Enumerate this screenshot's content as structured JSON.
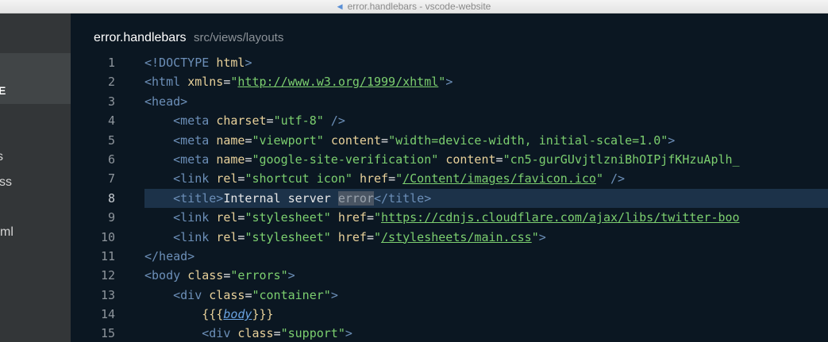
{
  "window": {
    "title": "error.handlebars - vscode-website"
  },
  "sidebar": {
    "section_title": "TE",
    "items": [
      {
        "label": "s"
      },
      {
        "label": "css"
      },
      {
        "label": "xml"
      }
    ]
  },
  "editor": {
    "file_name": "error.handlebars",
    "file_path": "src/views/layouts",
    "highlighted_line": 8,
    "lines": [
      {
        "n": "1",
        "tokens": [
          [
            "tag",
            "<!DOCTYPE "
          ],
          [
            "attr",
            "html"
          ],
          [
            "tag",
            ">"
          ]
        ]
      },
      {
        "n": "2",
        "tokens": [
          [
            "tag",
            "<html "
          ],
          [
            "attr",
            "xmlns"
          ],
          [
            "eq",
            "="
          ],
          [
            "str",
            "\""
          ],
          [
            "link",
            "http://www.w3.org/1999/xhtml"
          ],
          [
            "str",
            "\""
          ],
          [
            "tag",
            ">"
          ]
        ]
      },
      {
        "n": "3",
        "tokens": [
          [
            "tag",
            "<head>"
          ]
        ]
      },
      {
        "n": "4",
        "tokens": [
          [
            "txt",
            "    "
          ],
          [
            "tag",
            "<meta "
          ],
          [
            "attr",
            "charset"
          ],
          [
            "eq",
            "="
          ],
          [
            "str",
            "\"utf-8\""
          ],
          [
            "tag",
            " />"
          ]
        ]
      },
      {
        "n": "5",
        "tokens": [
          [
            "txt",
            "    "
          ],
          [
            "tag",
            "<meta "
          ],
          [
            "attr",
            "name"
          ],
          [
            "eq",
            "="
          ],
          [
            "str",
            "\"viewport\""
          ],
          [
            "txt",
            " "
          ],
          [
            "attr",
            "content"
          ],
          [
            "eq",
            "="
          ],
          [
            "str",
            "\"width=device-width, initial-scale=1.0\""
          ],
          [
            "tag",
            ">"
          ]
        ]
      },
      {
        "n": "6",
        "tokens": [
          [
            "txt",
            "    "
          ],
          [
            "tag",
            "<meta "
          ],
          [
            "attr",
            "name"
          ],
          [
            "eq",
            "="
          ],
          [
            "str",
            "\"google-site-verification\""
          ],
          [
            "txt",
            " "
          ],
          [
            "attr",
            "content"
          ],
          [
            "eq",
            "="
          ],
          [
            "str",
            "\"cn5-gurGUvjtlzniBhOIPjfKHzuAplh_"
          ]
        ]
      },
      {
        "n": "7",
        "tokens": [
          [
            "txt",
            "    "
          ],
          [
            "tag",
            "<link "
          ],
          [
            "attr",
            "rel"
          ],
          [
            "eq",
            "="
          ],
          [
            "str",
            "\"shortcut icon\""
          ],
          [
            "txt",
            " "
          ],
          [
            "attr",
            "href"
          ],
          [
            "eq",
            "="
          ],
          [
            "str",
            "\""
          ],
          [
            "link",
            "/Content/images/favicon.ico"
          ],
          [
            "str",
            "\""
          ],
          [
            "tag",
            " />"
          ]
        ]
      },
      {
        "n": "8",
        "tokens": [
          [
            "txt",
            "    "
          ],
          [
            "tag",
            "<title>"
          ],
          [
            "txt",
            "Internal server "
          ],
          [
            "match",
            "error"
          ],
          [
            "tag",
            "</title>"
          ]
        ]
      },
      {
        "n": "9",
        "tokens": [
          [
            "txt",
            "    "
          ],
          [
            "tag",
            "<link "
          ],
          [
            "attr",
            "rel"
          ],
          [
            "eq",
            "="
          ],
          [
            "str",
            "\"stylesheet\""
          ],
          [
            "txt",
            " "
          ],
          [
            "attr",
            "href"
          ],
          [
            "eq",
            "="
          ],
          [
            "str",
            "\""
          ],
          [
            "link",
            "https://cdnjs.cloudflare.com/ajax/libs/twitter-boo"
          ]
        ]
      },
      {
        "n": "10",
        "tokens": [
          [
            "txt",
            "    "
          ],
          [
            "tag",
            "<link "
          ],
          [
            "attr",
            "rel"
          ],
          [
            "eq",
            "="
          ],
          [
            "str",
            "\"stylesheet\""
          ],
          [
            "txt",
            " "
          ],
          [
            "attr",
            "href"
          ],
          [
            "eq",
            "="
          ],
          [
            "str",
            "\""
          ],
          [
            "link",
            "/stylesheets/main.css"
          ],
          [
            "str",
            "\""
          ],
          [
            "tag",
            ">"
          ]
        ]
      },
      {
        "n": "11",
        "tokens": [
          [
            "tag",
            "</head>"
          ]
        ]
      },
      {
        "n": "12",
        "tokens": [
          [
            "tag",
            "<body "
          ],
          [
            "attr",
            "class"
          ],
          [
            "eq",
            "="
          ],
          [
            "str",
            "\"errors\""
          ],
          [
            "tag",
            ">"
          ]
        ]
      },
      {
        "n": "13",
        "tokens": [
          [
            "txt",
            "    "
          ],
          [
            "tag",
            "<div "
          ],
          [
            "attr",
            "class"
          ],
          [
            "eq",
            "="
          ],
          [
            "str",
            "\"container\""
          ],
          [
            "tag",
            ">"
          ]
        ]
      },
      {
        "n": "14",
        "tokens": [
          [
            "txt",
            "        "
          ],
          [
            "brace",
            "{{{"
          ],
          [
            "var",
            "body"
          ],
          [
            "brace",
            "}}}"
          ]
        ]
      },
      {
        "n": "15",
        "tokens": [
          [
            "txt",
            "        "
          ],
          [
            "tag",
            "<div "
          ],
          [
            "attr",
            "class"
          ],
          [
            "eq",
            "="
          ],
          [
            "str",
            "\"support\""
          ],
          [
            "tag",
            ">"
          ]
        ]
      }
    ]
  }
}
